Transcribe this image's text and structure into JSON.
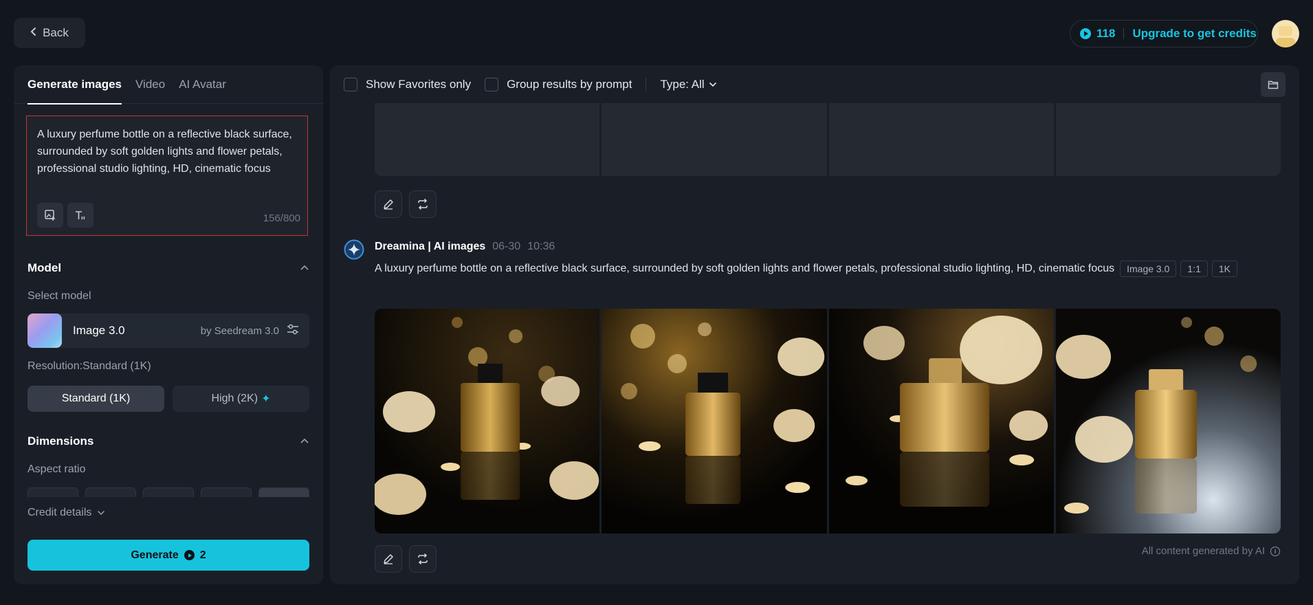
{
  "header": {
    "back_label": "Back",
    "credits_count": "118",
    "upgrade_label": "Upgrade to get credits"
  },
  "left_panel": {
    "tabs": [
      {
        "label": "Generate images",
        "active": true
      },
      {
        "label": "Video",
        "active": false
      },
      {
        "label": "AI Avatar",
        "active": false
      }
    ],
    "prompt": {
      "value": "A luxury perfume bottle on a reflective black surface, surrounded by soft golden lights and flower petals, professional studio lighting, HD, cinematic focus",
      "char_count": "156/800"
    },
    "model_section": {
      "title": "Model",
      "select_label": "Select model",
      "model_name": "Image 3.0",
      "model_by": "by Seedream 3.0",
      "resolution_label": "Resolution:Standard (1K)",
      "resolutions": [
        {
          "label": "Standard (1K)",
          "selected": true
        },
        {
          "label": "High (2K)",
          "selected": false
        }
      ]
    },
    "dimensions_section": {
      "title": "Dimensions",
      "aspect_label": "Aspect ratio"
    },
    "credit_details_label": "Credit details",
    "generate_label": "Generate",
    "generate_cost": "2"
  },
  "right_panel": {
    "filters": {
      "favorites_label": "Show Favorites only",
      "group_label": "Group results by prompt",
      "type_label": "Type: All"
    },
    "generation": {
      "source": "Dreamina | AI images",
      "date": "06-30",
      "time": "10:36",
      "prompt": "A luxury perfume bottle on a reflective black surface, surrounded by soft golden lights and flower petals, professional studio lighting, HD, cinematic focus",
      "tags": [
        "Image 3.0",
        "1:1",
        "1K"
      ]
    },
    "disclaimer": "All content generated by AI"
  },
  "colors": {
    "accent": "#17c3dc",
    "background": "#12161d",
    "panel": "#1a1f27"
  }
}
